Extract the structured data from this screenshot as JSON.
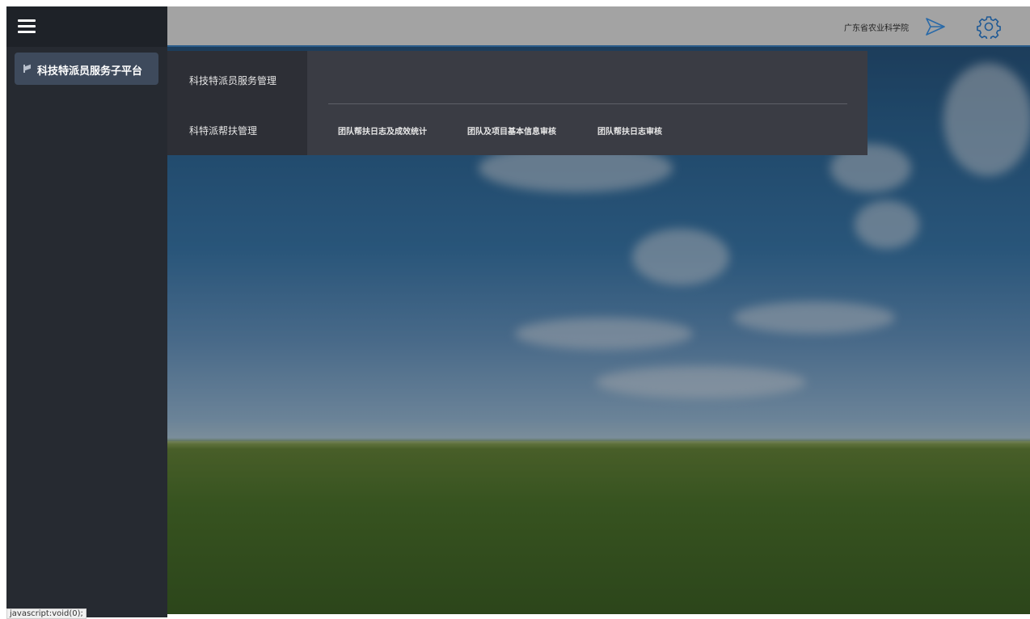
{
  "header": {
    "org_name": "广东省农业科学院",
    "icons": [
      "send-icon",
      "gear-icon"
    ]
  },
  "sidebar": {
    "menu_icon": "hamburger-menu-icon",
    "items": [
      {
        "label": "科技特派员服务子平台",
        "icon": "flag-icon"
      }
    ]
  },
  "dropdown": {
    "categories": [
      {
        "label": "科技特派员服务管理"
      },
      {
        "label": "科特派帮扶管理"
      }
    ],
    "sub_items": [
      {
        "label": "团队帮扶日志及成效统计"
      },
      {
        "label": "团队及项目基本信息审核"
      },
      {
        "label": "团队帮扶日志审核"
      }
    ]
  },
  "status_bar": {
    "url": "javascript:void(0);"
  },
  "colors": {
    "sidebar_bg": "#262a31",
    "sidebar_active": "#3e4a5c",
    "header_bg": "#a3a3a3",
    "dropdown_bg": "#3a3c44"
  }
}
